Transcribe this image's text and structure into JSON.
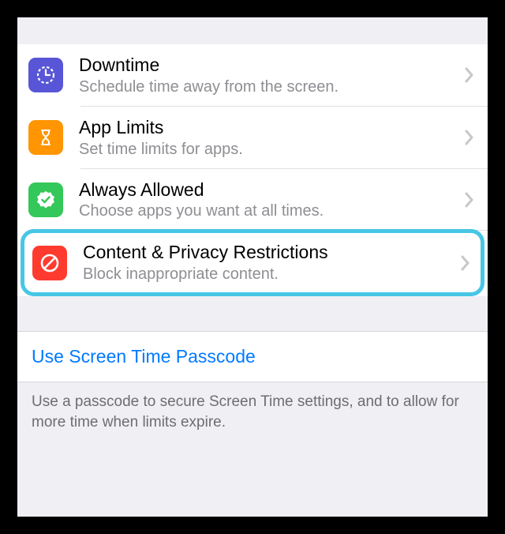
{
  "rows": [
    {
      "title": "Downtime",
      "subtitle": "Schedule time away from the screen.",
      "icon": "downtime-icon",
      "color": "purple"
    },
    {
      "title": "App Limits",
      "subtitle": "Set time limits for apps.",
      "icon": "hourglass-icon",
      "color": "orange"
    },
    {
      "title": "Always Allowed",
      "subtitle": "Choose apps you want at all times.",
      "icon": "checkmark-seal-icon",
      "color": "green"
    },
    {
      "title": "Content & Privacy Restrictions",
      "subtitle": "Block inappropriate content.",
      "icon": "no-sign-icon",
      "color": "red"
    }
  ],
  "link": {
    "label": "Use Screen Time Passcode"
  },
  "footer": "Use a passcode to secure Screen Time settings, and to allow for more time when limits expire."
}
